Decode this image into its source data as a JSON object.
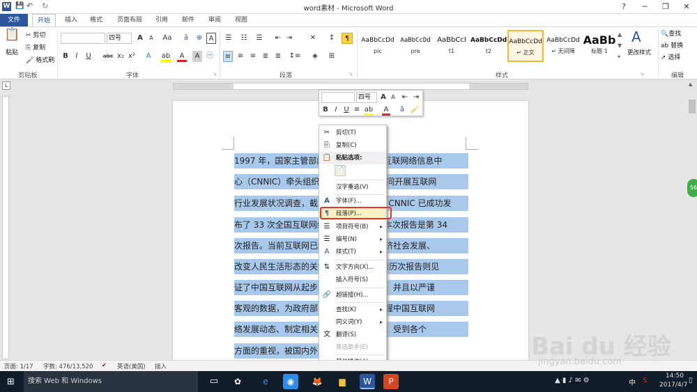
{
  "window": {
    "title": "word素材 - Microsoft Word",
    "minimize": "─",
    "restore": "❐",
    "close": "✕"
  },
  "tabs": [
    "文件",
    "开始",
    "插入",
    "格式",
    "页面布局",
    "引用",
    "邮件",
    "审阅",
    "视图"
  ],
  "ribbon": {
    "clipboard": {
      "paste": "粘贴",
      "cut": "剪切",
      "copy": "复制",
      "format_painter": "格式刷",
      "label": "剪贴板"
    },
    "font": {
      "font_name": "",
      "font_size": "四号",
      "grow": "A",
      "shrink": "A",
      "change_case": "Aa",
      "clear": "A",
      "bold": "B",
      "italic": "I",
      "underline": "U",
      "strike": "abc",
      "sub": "x₂",
      "sup": "x²",
      "text_effect": "A",
      "highlight": "ab",
      "color": "A",
      "char_shading": "A",
      "char_border": "A",
      "label": "字体"
    },
    "paragraph": {
      "label": "段落"
    },
    "styles": {
      "label": "样式",
      "items": [
        {
          "sample": "AaBbCcDd",
          "name": "pic"
        },
        {
          "sample": "AaBbCcDd",
          "name": "pre"
        },
        {
          "sample": "AaBbCcI",
          "name": "t1"
        },
        {
          "sample": "AaBbCcDd",
          "name": "t2"
        },
        {
          "sample": "AaBbCcDd",
          "name": "↵ 正文"
        },
        {
          "sample": "AaBbCcDd",
          "name": "↵ 无间隔"
        },
        {
          "sample": "AaBb",
          "name": "标题 1"
        }
      ],
      "change": "更改样式"
    },
    "editing": {
      "find": "查找",
      "replace": "替换",
      "select": "选择",
      "label": "编辑"
    }
  },
  "minibar": {
    "font_name": "",
    "font_size": "四号"
  },
  "document": {
    "lines": [
      "1997 年，国家主管部门研究决定由中国互联网络信息中",
      "心（CNNIC）牵头组织有关互联网单位共同开展互联网",
      "行业发展状况调查，截至 2014 年 1 月，CNNIC 已成功发",
      "布了 33 次全国互联网络发展统计报告，本次报告是第 34",
      "次报告。当前互联网已经成为影响我国经济社会发展、",
      "改变人民生活形态的关键行业。CNNIC 的历次报告则见",
      "证了中国互联网从起步到腾飞的全部历程，并且以严谨",
      "客观的数据，为政府部门、企业等各界掌握中国互联网",
      "络发展动态、制定相关决策提供重要依据，受到各个",
      "方面的重视，被国内外广泛引用。"
    ]
  },
  "context_menu": {
    "items": [
      {
        "icon": "✂",
        "label": "剪切(T)"
      },
      {
        "icon": "⎘",
        "label": "复制(C)"
      },
      {
        "icon": "📋",
        "label": "粘贴选项:"
      },
      {
        "icon": "",
        "label": "汉字重选(V)"
      },
      {
        "icon": "A",
        "label": "字体(F)..."
      },
      {
        "icon": "¶",
        "label": "段落(P)..."
      },
      {
        "icon": "☰",
        "label": "项目符号(B)",
        "arrow": "▸"
      },
      {
        "icon": "☰",
        "label": "编号(N)",
        "arrow": "▸"
      },
      {
        "icon": "A",
        "label": "样式(T)",
        "arrow": "▸"
      },
      {
        "icon": "⇅",
        "label": "文字方向(X)..."
      },
      {
        "icon": "",
        "label": "插入符号(S)"
      },
      {
        "icon": "🔗",
        "label": "超链接(H)..."
      },
      {
        "icon": "",
        "label": "查找(K)",
        "arrow": "▸"
      },
      {
        "icon": "",
        "label": "同义词(Y)",
        "arrow": "▸"
      },
      {
        "icon": "文",
        "label": "翻译(S)"
      },
      {
        "icon": "",
        "label": "英语助手(E)"
      },
      {
        "icon": "",
        "label": "其他操作(A)",
        "arrow": "▸"
      }
    ]
  },
  "statusbar": {
    "page": "页面: 1/17",
    "words": "字数: 476/13,520",
    "lang": "英语(美国)",
    "mode": "插入"
  },
  "taskbar": {
    "search": "搜索 Web 和 Windows",
    "time": "14:50",
    "date": "2017/4/7",
    "ime": "中"
  },
  "watermark": {
    "brand": "Bai du 经验",
    "url": "jingyan.baidu.com"
  },
  "badge": "56"
}
